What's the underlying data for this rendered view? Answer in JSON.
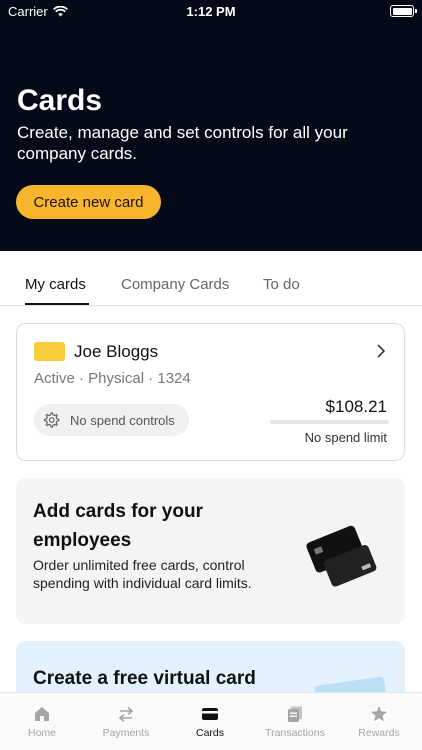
{
  "status_bar": {
    "carrier": "Carrier",
    "time": "1:12 PM"
  },
  "header": {
    "title": "Cards",
    "subtitle": "Create, manage and set controls for all your company cards.",
    "create_button": "Create new card"
  },
  "tabs": [
    {
      "label": "My cards",
      "active": true
    },
    {
      "label": "Company Cards",
      "active": false
    },
    {
      "label": "To do",
      "active": false
    }
  ],
  "card": {
    "holder": "Joe Bloggs",
    "status": "Active",
    "kind": "Physical",
    "last4": "1324",
    "meta": "Active · Physical · 1324",
    "controls": "No spend controls",
    "amount": "$108.21",
    "limit_label": "No spend limit",
    "chip_color": "#f7cd3c"
  },
  "promo": {
    "title": "Add cards for your employees",
    "text": "Order unlimited free cards, control spending with individual card limits."
  },
  "promo2": {
    "title": "Create a free virtual card"
  },
  "tab_bar": [
    {
      "label": "Home",
      "icon": "home-icon",
      "active": false
    },
    {
      "label": "Payments",
      "icon": "transfer-arrows-icon",
      "active": false
    },
    {
      "label": "Cards",
      "icon": "card-icon",
      "active": true
    },
    {
      "label": "Transactions",
      "icon": "receipt-icon",
      "active": false
    },
    {
      "label": "Rewards",
      "icon": "star-icon",
      "active": false
    }
  ],
  "colors": {
    "hero_bg": "#040a17",
    "accent": "#f9b52d",
    "promo_bg": "#f4f4f4",
    "virtual_bg": "#e3f1fc"
  }
}
